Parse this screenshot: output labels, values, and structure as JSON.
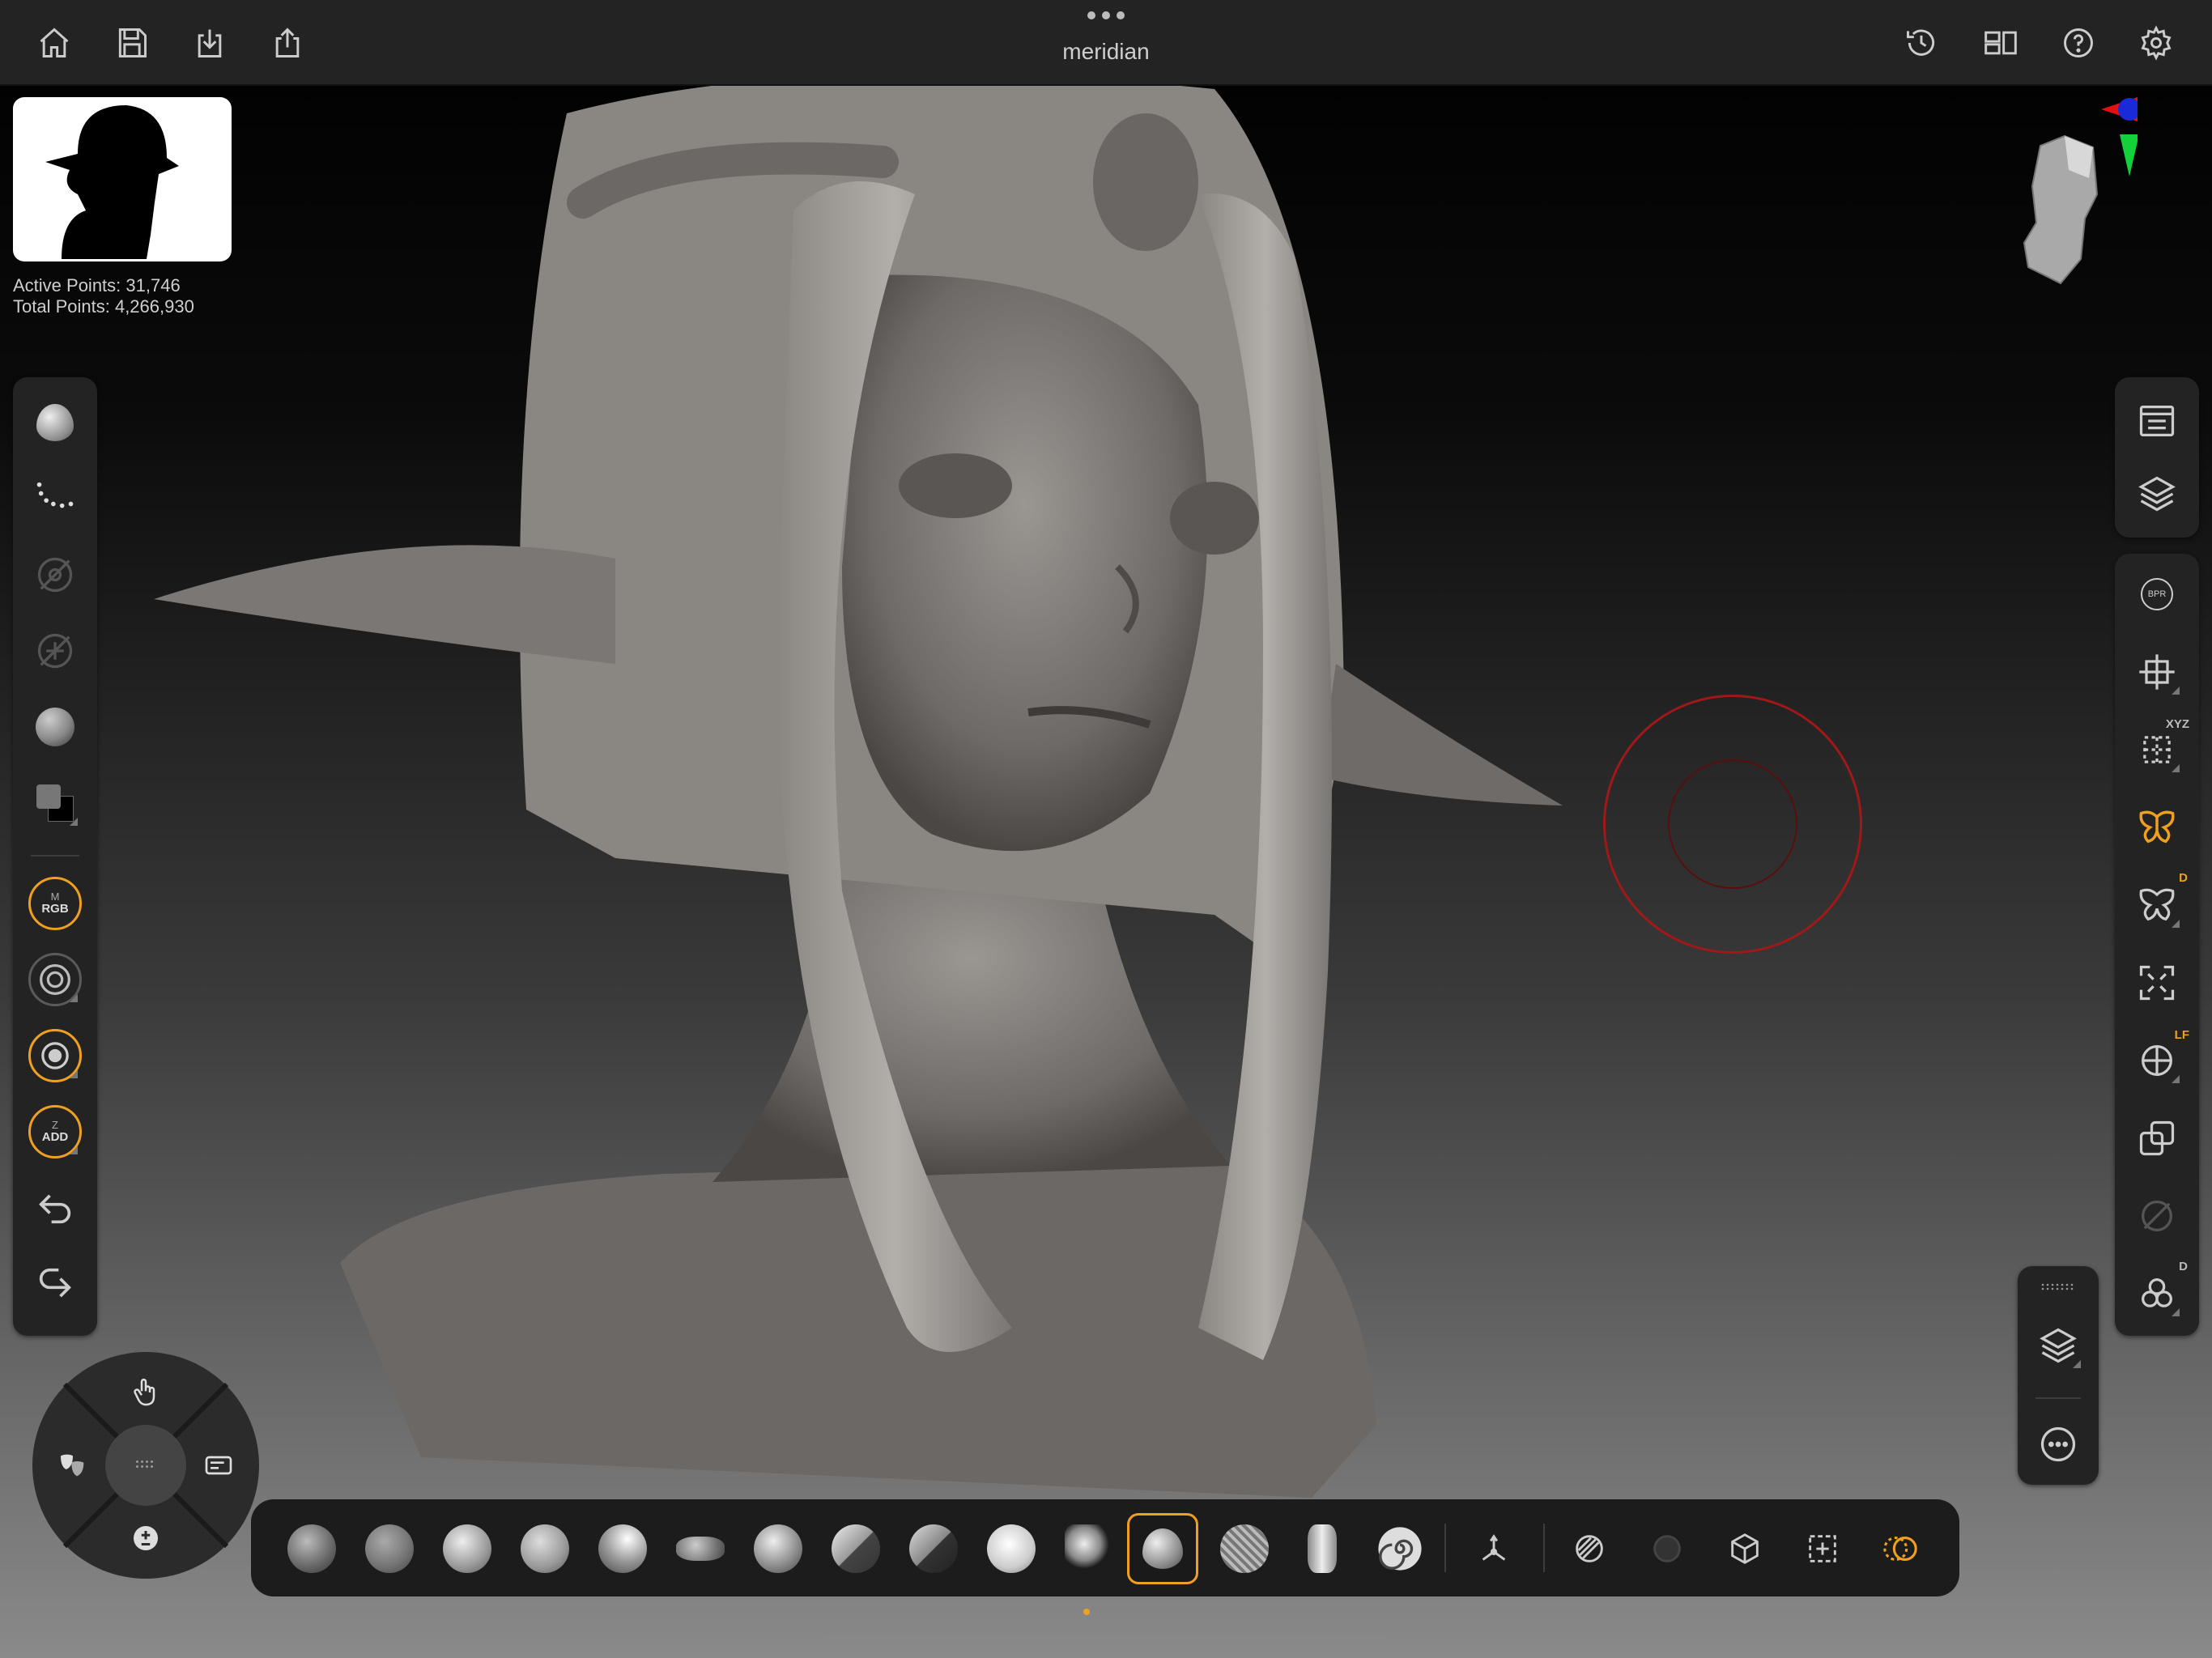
{
  "app": {
    "document_title": "meridian"
  },
  "topbar": {
    "left_icons": [
      "home-icon",
      "save-icon",
      "import-icon",
      "share-icon"
    ],
    "right_icons": [
      "history-icon",
      "layout-icon",
      "help-icon",
      "settings-icon"
    ]
  },
  "stats": {
    "active_points": "Active Points: 31,746",
    "total_points": "Total Points: 4,266,930"
  },
  "left_toolbar": {
    "rgb_label_top": "M",
    "rgb_label_bottom": "RGB",
    "zadd_label_top": "Z",
    "zadd_label_bottom": "ADD"
  },
  "right_panel_top": {
    "icons": [
      "subtool-list-icon",
      "layers-icon"
    ]
  },
  "right_panel_main": {
    "bpr_label": "BPR",
    "xyz_label": "XYZ",
    "symmetry_d_label": "D",
    "lf_label": "LF",
    "subtools_d_label": "D"
  },
  "brushes": [
    {
      "name": "clay-buildup-brush"
    },
    {
      "name": "clay-tubes-brush"
    },
    {
      "name": "standard-brush"
    },
    {
      "name": "dam-standard-brush"
    },
    {
      "name": "inflate-brush"
    },
    {
      "name": "move-brush"
    },
    {
      "name": "move-topological-brush"
    },
    {
      "name": "trim-dynamic-brush"
    },
    {
      "name": "hpolish-brush"
    },
    {
      "name": "smooth-brush"
    },
    {
      "name": "snakehook-brush"
    },
    {
      "name": "selected-brush"
    },
    {
      "name": "mesh-insert-brush"
    },
    {
      "name": "curve-tube-brush"
    },
    {
      "name": "spiral-brush"
    }
  ],
  "colors": {
    "accent": "#f0a020",
    "panel": "#232323",
    "cursor_red": "#a01818"
  }
}
